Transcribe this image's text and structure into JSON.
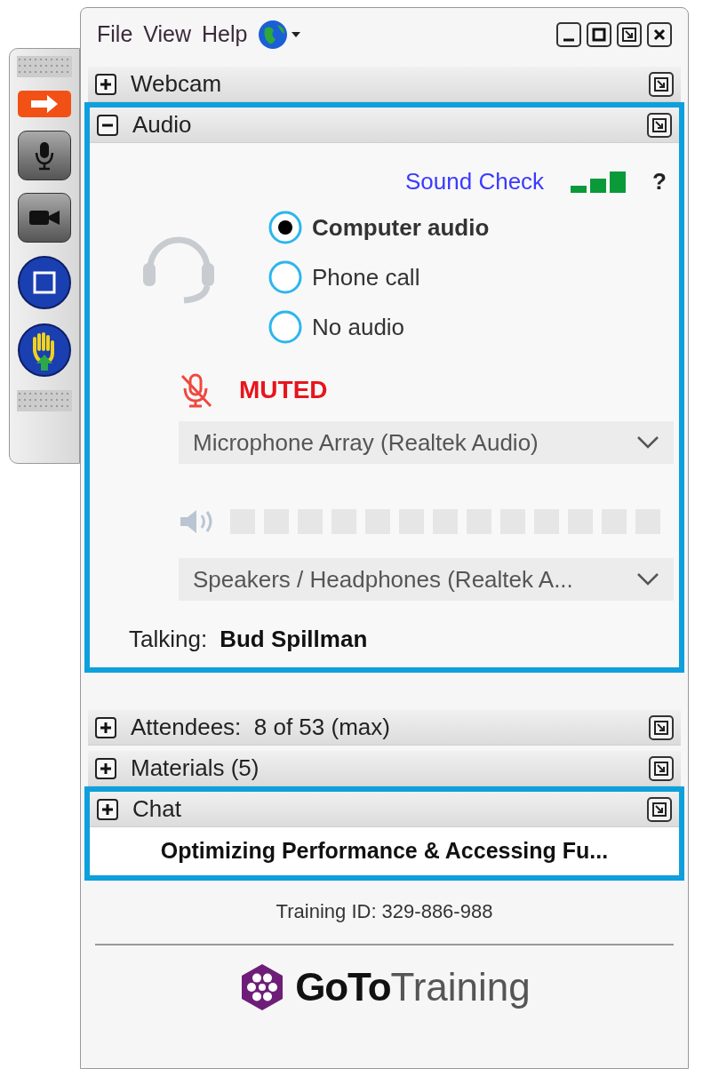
{
  "menu": [
    "File",
    "View",
    "Help"
  ],
  "sections": [
    {
      "title": "Webcam",
      "expanded": false,
      "highlighted": false
    },
    {
      "title": "Audio",
      "expanded": true,
      "highlighted": true
    },
    {
      "title": "Attendees:  8 of 53 (max)",
      "expanded": false,
      "highlighted": false
    },
    {
      "title": "Materials (5)",
      "expanded": false,
      "highlighted": false
    },
    {
      "title": "Chat",
      "expanded": false,
      "highlighted": true
    }
  ],
  "audio": {
    "sound_check": "Sound Check",
    "help": "?",
    "options": [
      {
        "label": "Computer audio",
        "selected": true
      },
      {
        "label": "Phone call",
        "selected": false
      },
      {
        "label": "No audio",
        "selected": false
      }
    ],
    "muted": true,
    "muted_label": "MUTED",
    "microphone": "Microphone Array (Realtek Audio)",
    "speakers": "Speakers / Headphones (Realtek A...",
    "talking_label": "Talking:",
    "talking_name": "Bud Spillman"
  },
  "training_title": "Optimizing Performance & Accessing Fu...",
  "training_id": "Training ID: 329-886-988",
  "logo": {
    "bold": "GoTo",
    "light": "Training"
  }
}
